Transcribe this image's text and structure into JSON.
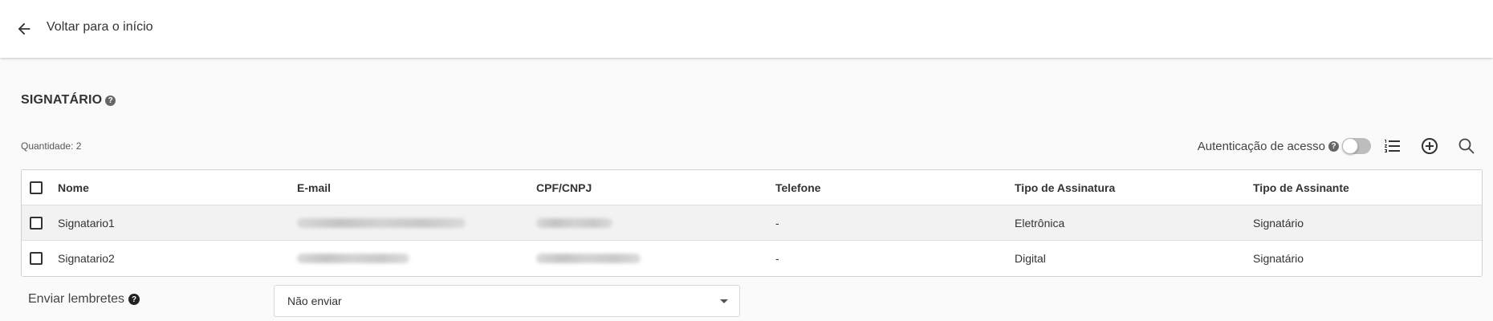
{
  "header": {
    "back_label": "Voltar para o início",
    "back_icon": "arrow-left-icon"
  },
  "section": {
    "title": "SIGNATÁRIO",
    "help_icon": "help-circle-icon"
  },
  "quantity_text": "Quantidade: 2",
  "toolbar": {
    "auth_label": "Autenticação de acesso",
    "auth_enabled": false,
    "list_icon": "ordered-list-icon",
    "add_icon": "add-circle-icon",
    "search_icon": "search-icon"
  },
  "table": {
    "columns": [
      "Nome",
      "E-mail",
      "CPF/CNPJ",
      "Telefone",
      "Tipo de Assinatura",
      "Tipo de Assinante"
    ],
    "rows": [
      {
        "nome": "Signatario1",
        "email": "",
        "cpf": "",
        "telefone": "-",
        "tipo_assinatura": "Eletrônica",
        "tipo_assinante": "Signatário"
      },
      {
        "nome": "Signatario2",
        "email": "",
        "cpf": "",
        "telefone": "-",
        "tipo_assinatura": "Digital",
        "tipo_assinante": "Signatário"
      }
    ]
  },
  "reminders": {
    "label": "Enviar lembretes",
    "selected": "Não enviar"
  },
  "colors": {
    "background": "#fafafa",
    "topbar": "#ffffff",
    "text": "#333333",
    "toggle_off": "#bdbdbd"
  }
}
